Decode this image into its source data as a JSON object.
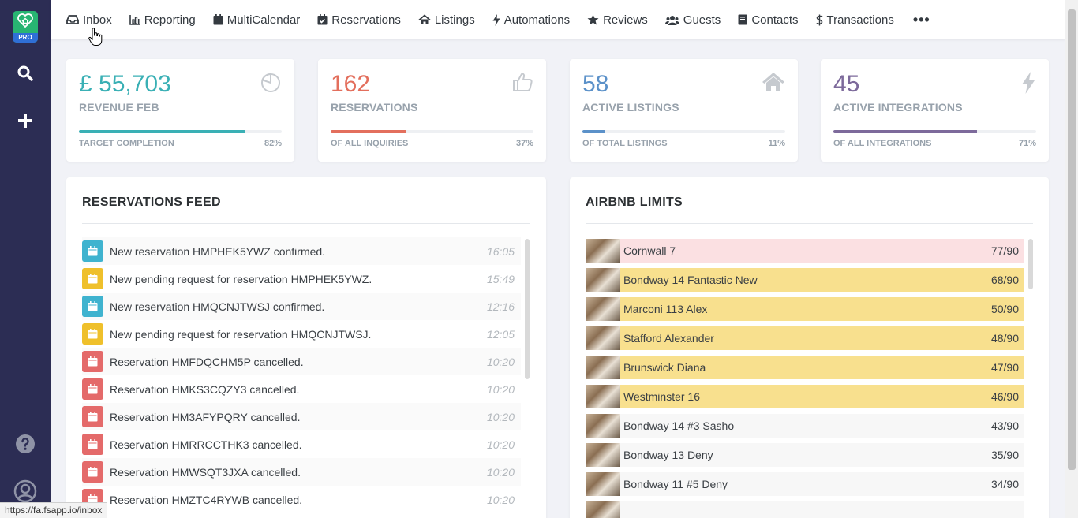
{
  "sidebar": {
    "logo_badge": "PRO",
    "icons": [
      "heart-home-logo",
      "search-icon",
      "plus-icon",
      "help-icon",
      "user-icon"
    ]
  },
  "nav": [
    {
      "label": "Inbox",
      "icon": "inbox-icon"
    },
    {
      "label": "Reporting",
      "icon": "bar-chart-icon"
    },
    {
      "label": "MultiCalendar",
      "icon": "calendar-icon"
    },
    {
      "label": "Reservations",
      "icon": "calendar-check-icon"
    },
    {
      "label": "Listings",
      "icon": "home-icon"
    },
    {
      "label": "Automations",
      "icon": "bolt-icon"
    },
    {
      "label": "Reviews",
      "icon": "star-icon"
    },
    {
      "label": "Guests",
      "icon": "users-icon"
    },
    {
      "label": "Contacts",
      "icon": "address-book-icon"
    },
    {
      "label": "Transactions",
      "icon": "dollar-icon"
    }
  ],
  "nav_more": "•••",
  "stats": [
    {
      "value": "£ 55,703",
      "label": "REVENUE FEB",
      "sub": "TARGET COMPLETION",
      "pct": "82%",
      "progress": 0.82,
      "color": "#3ab0b5",
      "icon": "pie-chart-icon"
    },
    {
      "value": "162",
      "label": "RESERVATIONS",
      "sub": "OF ALL INQUIRIES",
      "pct": "37%",
      "progress": 0.37,
      "color": "#e36f5d",
      "icon": "thumbs-up-icon"
    },
    {
      "value": "58",
      "label": "ACTIVE LISTINGS",
      "sub": "OF TOTAL LISTINGS",
      "pct": "11%",
      "progress": 0.11,
      "color": "#5b91c9",
      "icon": "home-icon"
    },
    {
      "value": "45",
      "label": "ACTIVE INTEGRATIONS",
      "sub": "OF ALL INTEGRATIONS",
      "pct": "71%",
      "progress": 0.71,
      "color": "#7d6a9b",
      "icon": "bolt-icon"
    }
  ],
  "feed": {
    "title": "RESERVATIONS FEED",
    "items": [
      {
        "text": "New reservation HMPHEK5YWZ confirmed.",
        "time": "16:05",
        "kind": "confirmed"
      },
      {
        "text": "New pending request for reservation HMPHEK5YWZ.",
        "time": "15:49",
        "kind": "pending"
      },
      {
        "text": "New reservation HMQCNJTWSJ confirmed.",
        "time": "12:16",
        "kind": "confirmed"
      },
      {
        "text": "New pending request for reservation HMQCNJTWSJ.",
        "time": "12:05",
        "kind": "pending"
      },
      {
        "text": "Reservation HMFDQCHM5P cancelled.",
        "time": "10:20",
        "kind": "cancelled"
      },
      {
        "text": "Reservation HMKS3CQZY3 cancelled.",
        "time": "10:20",
        "kind": "cancelled"
      },
      {
        "text": "Reservation HM3AFYPQRY cancelled.",
        "time": "10:20",
        "kind": "cancelled"
      },
      {
        "text": "Reservation HMRRCCTHK3 cancelled.",
        "time": "10:20",
        "kind": "cancelled"
      },
      {
        "text": "Reservation HMWSQT3JXA cancelled.",
        "time": "10:20",
        "kind": "cancelled"
      },
      {
        "text": "Reservation HMZTC4RYWB cancelled.",
        "time": "10:20",
        "kind": "cancelled"
      }
    ],
    "kind_colors": {
      "confirmed": "#3fb3cf",
      "pending": "#efc02b",
      "cancelled": "#e46a6a"
    }
  },
  "limits": {
    "title": "AIRBNB LIMITS",
    "items": [
      {
        "name": "Cornwall 7",
        "value": "77/90",
        "level": "high"
      },
      {
        "name": "Bondway 14 Fantastic New",
        "value": "68/90",
        "level": "mid"
      },
      {
        "name": "Marconi 113 Alex",
        "value": "50/90",
        "level": "mid"
      },
      {
        "name": "Stafford Alexander",
        "value": "48/90",
        "level": "mid"
      },
      {
        "name": "Brunswick Diana",
        "value": "47/90",
        "level": "mid"
      },
      {
        "name": "Westminster 16",
        "value": "46/90",
        "level": "mid"
      },
      {
        "name": "Bondway 14 #3 Sasho",
        "value": "43/90",
        "level": "low"
      },
      {
        "name": "Bondway 13 Deny",
        "value": "35/90",
        "level": "low"
      },
      {
        "name": "Bondway 11 #5 Deny",
        "value": "34/90",
        "level": "low"
      },
      {
        "name": "",
        "value": "",
        "level": "low"
      }
    ],
    "level_colors": {
      "high": "#fbe0e2",
      "mid": "#f8e08e",
      "low": "#f7f7f7"
    }
  },
  "status_url": "https://fa.fsapp.io/inbox"
}
